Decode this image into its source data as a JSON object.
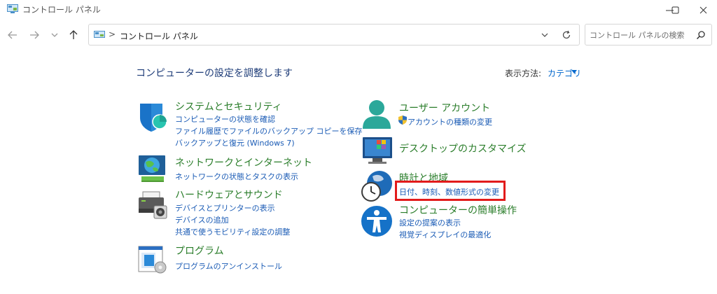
{
  "window": {
    "title": "コントロール パネル"
  },
  "address": {
    "separator": ">",
    "path": "コントロール パネル"
  },
  "search": {
    "placeholder": "コントロール パネルの検索"
  },
  "header": {
    "title": "コンピューターの設定を調整します",
    "view_label": "表示方法:",
    "view_value": "カテゴリ"
  },
  "categories": {
    "system": {
      "title": "システムとセキュリティ",
      "links": [
        "コンピューターの状態を確認",
        "ファイル履歴でファイルのバックアップ コピーを保存",
        "バックアップと復元 (Windows 7)"
      ]
    },
    "network": {
      "title": "ネットワークとインターネット",
      "links": [
        "ネットワークの状態とタスクの表示"
      ]
    },
    "hardware": {
      "title": "ハードウェアとサウンド",
      "links": [
        "デバイスとプリンターの表示",
        "デバイスの追加",
        "共通で使うモビリティ設定の調整"
      ]
    },
    "programs": {
      "title": "プログラム",
      "links": [
        "プログラムのアンインストール"
      ]
    },
    "user": {
      "title": "ユーザー アカウント",
      "links": [
        "アカウントの種類の変更"
      ]
    },
    "desktop": {
      "title": "デスクトップのカスタマイズ"
    },
    "clock": {
      "title": "時計と地域",
      "links": [
        "日付、時刻、数値形式の変更"
      ]
    },
    "ease": {
      "title": "コンピューターの簡単操作",
      "links": [
        "設定の提案の表示",
        "視覚ディスプレイの最適化"
      ]
    }
  },
  "icons": {
    "back": "arrow-left-icon",
    "forward": "arrow-right-icon",
    "recent": "chevron-down-icon",
    "up": "arrow-up-icon",
    "refresh": "refresh-icon",
    "search": "search-icon"
  },
  "colors": {
    "category_title": "#2a7d2a",
    "link": "#1a5bb5",
    "highlight": "#e21b1b"
  }
}
